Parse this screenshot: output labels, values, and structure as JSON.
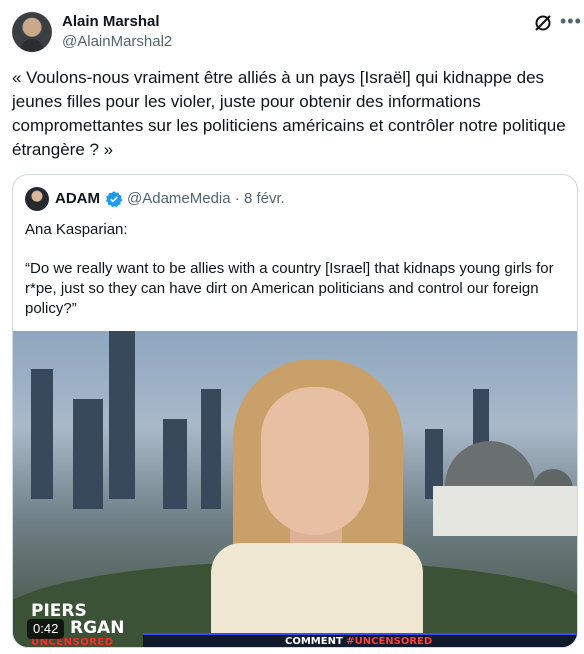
{
  "author": {
    "name": "Alain Marshal",
    "handle": "@AlainMarshal2"
  },
  "tweet_text": "« Voulons-nous vraiment être alliés à un pays [Israël] qui kidnappe des jeunes filles pour les violer, juste pour obtenir des informations compromettantes sur les politiciens américains et contrôler notre politique étrangère ? »",
  "quoted": {
    "name": "ADAM",
    "handle": "@AdameMedia",
    "separator": "·",
    "date": "8 févr.",
    "line1": "Ana Kasparian:",
    "line2": "“Do we really want to be allies with a country [Israel] that kidnaps young girls for r*pe, just so they can have dirt on American politicians and control our foreign policy?”",
    "video": {
      "timestamp": "0:42",
      "logo_line1": "PIERS",
      "logo_line2": "RGAN",
      "logo_line3": "UNCENSORED",
      "ticker_prefix": "COMMENT",
      "ticker_tag": "#UNCENSORED"
    }
  },
  "icons": {
    "grok": "grok-icon",
    "more": "more-icon",
    "verified": "verified-badge-icon"
  },
  "colors": {
    "verified": "#1d9bf0",
    "secondary_text": "#536471",
    "border": "#cfd9de"
  }
}
